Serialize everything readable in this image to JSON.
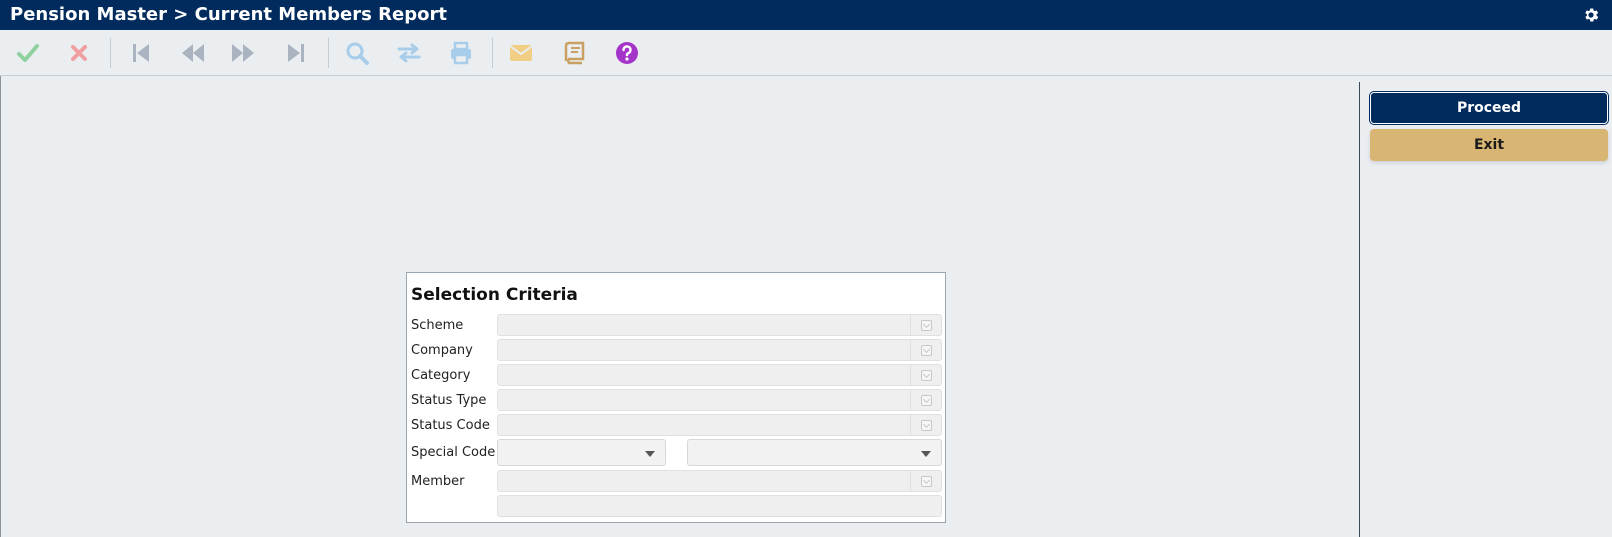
{
  "window": {
    "title": "Pension Master > Current Members Report"
  },
  "toolbar": {
    "buttons": [
      {
        "name": "confirm",
        "icon": "check-icon"
      },
      {
        "name": "cancel",
        "icon": "close-icon"
      },
      {
        "name": "first",
        "icon": "skip-first-icon"
      },
      {
        "name": "previous",
        "icon": "rewind-icon"
      },
      {
        "name": "next",
        "icon": "fast-forward-icon"
      },
      {
        "name": "last",
        "icon": "skip-last-icon"
      },
      {
        "name": "search",
        "icon": "search-icon"
      },
      {
        "name": "transfer",
        "icon": "swap-icon"
      },
      {
        "name": "print",
        "icon": "print-icon"
      },
      {
        "name": "email",
        "icon": "envelope-icon"
      },
      {
        "name": "notes",
        "icon": "book-icon"
      },
      {
        "name": "help",
        "icon": "help-icon"
      }
    ]
  },
  "actions": {
    "proceed_label": "Proceed",
    "exit_label": "Exit"
  },
  "selection_criteria": {
    "title": "Selection Criteria",
    "fields": {
      "scheme": {
        "label": "Scheme",
        "value": ""
      },
      "company": {
        "label": "Company",
        "value": ""
      },
      "category": {
        "label": "Category",
        "value": ""
      },
      "status_type": {
        "label": "Status Type",
        "value": ""
      },
      "status_code": {
        "label": "Status Code",
        "value": ""
      },
      "special_code": {
        "label": "Special Code",
        "value_1": "",
        "value_2": ""
      },
      "member": {
        "label": "Member",
        "value": "",
        "description": ""
      }
    }
  },
  "colors": {
    "header_bg": "#002b5c",
    "proceed_bg": "#002b5c",
    "exit_bg": "#d9b574",
    "page_bg": "#eaeef1"
  }
}
